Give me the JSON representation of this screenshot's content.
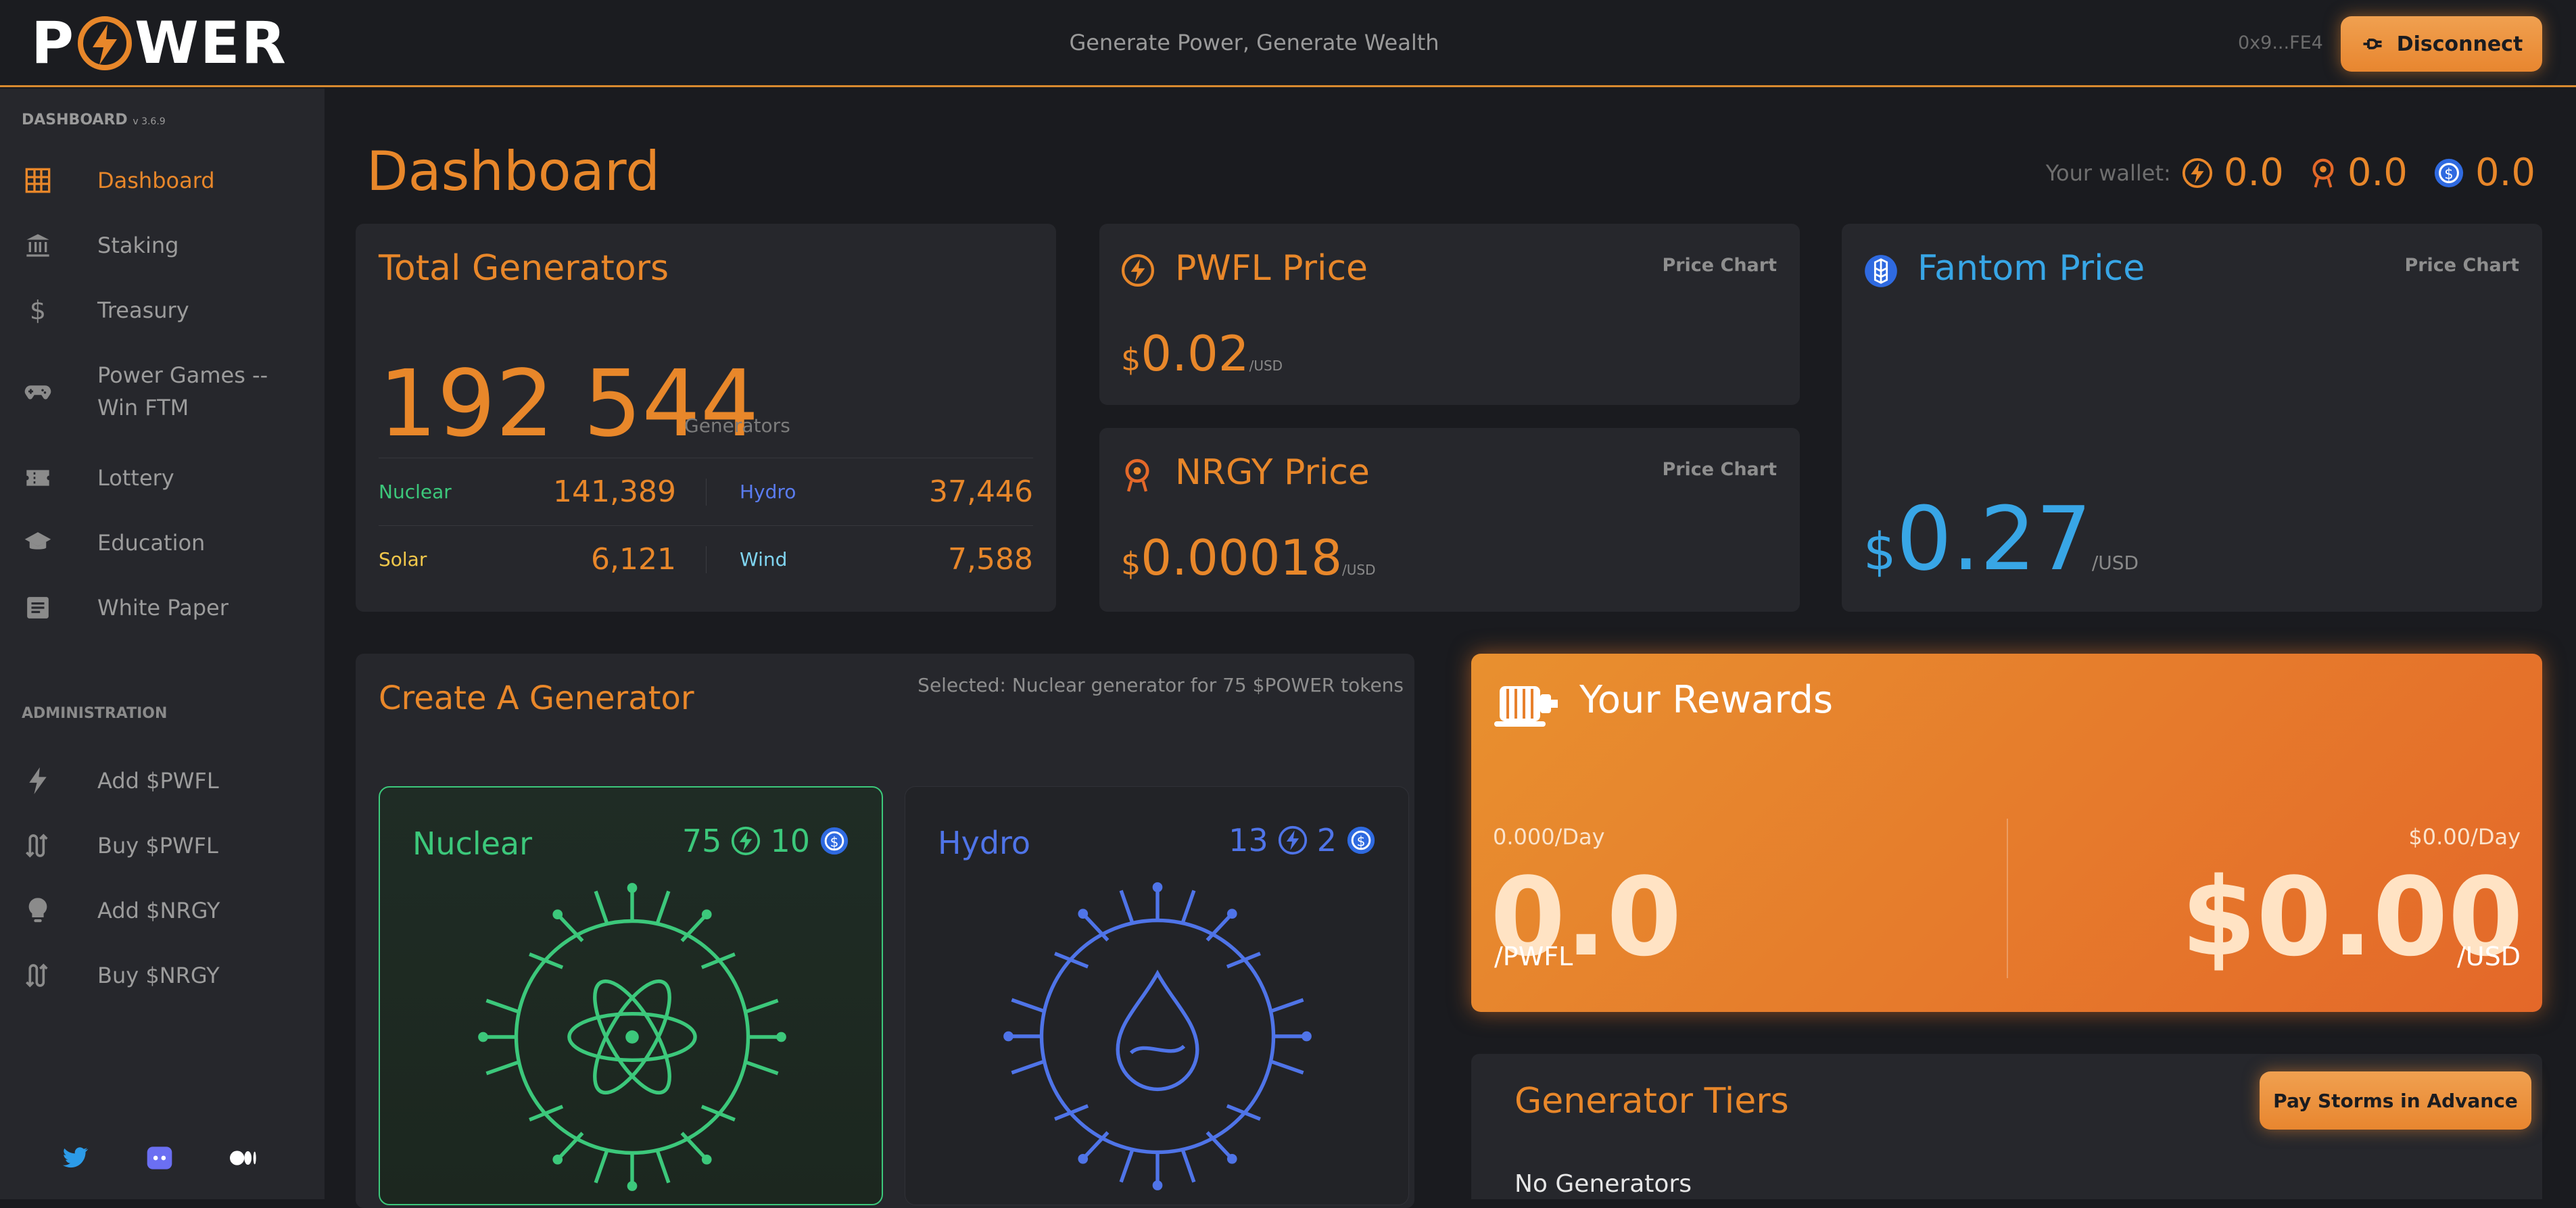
{
  "header": {
    "logo_text": "POWER",
    "tagline": "Generate Power, Generate Wealth",
    "address": "0x9...FE4",
    "disconnect_label": "Disconnect"
  },
  "sidebar": {
    "section_label": "DASHBOARD",
    "version": "v 3.6.9",
    "items": [
      {
        "label": "Dashboard",
        "icon": "grid-icon",
        "active": true
      },
      {
        "label": "Staking",
        "icon": "bank-icon"
      },
      {
        "label": "Treasury",
        "icon": "dollar-icon"
      },
      {
        "label": "Power Games -- Win FTM",
        "icon": "gamepad-icon"
      },
      {
        "label": "Lottery",
        "icon": "ticket-icon"
      },
      {
        "label": "Education",
        "icon": "graduation-cap-icon"
      },
      {
        "label": "White Paper",
        "icon": "document-icon"
      }
    ],
    "admin_label": "ADMINISTRATION",
    "admin_items": [
      {
        "label": "Add $PWFL",
        "icon": "bolt-icon"
      },
      {
        "label": "Buy $PWFL",
        "icon": "swap-icon"
      },
      {
        "label": "Add $NRGY",
        "icon": "bulb-icon"
      },
      {
        "label": "Buy $NRGY",
        "icon": "swap-icon"
      }
    ],
    "social": [
      "twitter-icon",
      "discord-icon",
      "medium-icon"
    ]
  },
  "main": {
    "title": "Dashboard",
    "wallet": {
      "label": "Your wallet:",
      "pwfl": "0.0",
      "nrgy": "0.0",
      "ftm": "0.0"
    },
    "total_generators": {
      "title": "Total Generators",
      "count": "192 544",
      "unit": "Generators",
      "nuclear_label": "Nuclear",
      "nuclear": "141,389",
      "hydro_label": "Hydro",
      "hydro": "37,446",
      "solar_label": "Solar",
      "solar": "6,121",
      "wind_label": "Wind",
      "wind": "7,588"
    },
    "pwfl_price": {
      "title": "PWFL Price",
      "chart_link": "Price Chart",
      "currency": "$",
      "value": "0.02",
      "unit": "/USD"
    },
    "nrgy_price": {
      "title": "NRGY Price",
      "chart_link": "Price Chart",
      "currency": "$",
      "value": "0.00018",
      "unit": "/USD"
    },
    "fantom_price": {
      "title": "Fantom Price",
      "chart_link": "Price Chart",
      "currency": "$",
      "value": "0.27",
      "unit": "/USD"
    },
    "create_generator": {
      "title": "Create A Generator",
      "selected_text": "Selected: Nuclear generator for 75 $POWER tokens",
      "generators": [
        {
          "name": "Nuclear",
          "cost_power": "75",
          "cost_ftm": "10",
          "color": "#3cc87b"
        },
        {
          "name": "Hydro",
          "cost_power": "13",
          "cost_ftm": "2",
          "color": "#4f74e8"
        }
      ]
    },
    "rewards": {
      "title": "Your Rewards",
      "left_rate": "0.000/Day",
      "left_value": "0.0",
      "left_unit": "/PWFL",
      "right_rate": "$0.00/Day",
      "right_value": "$0.00",
      "right_unit": "/USD"
    },
    "tiers": {
      "title": "Generator Tiers",
      "button": "Pay Storms in Advance",
      "empty": "No Generators"
    }
  },
  "colors": {
    "accent": "#e8872a",
    "nuclear": "#3cc87b",
    "hydro": "#4f74e8",
    "solar": "#f2c84b",
    "wind": "#7fd4f0",
    "fantom": "#38a6e6"
  }
}
